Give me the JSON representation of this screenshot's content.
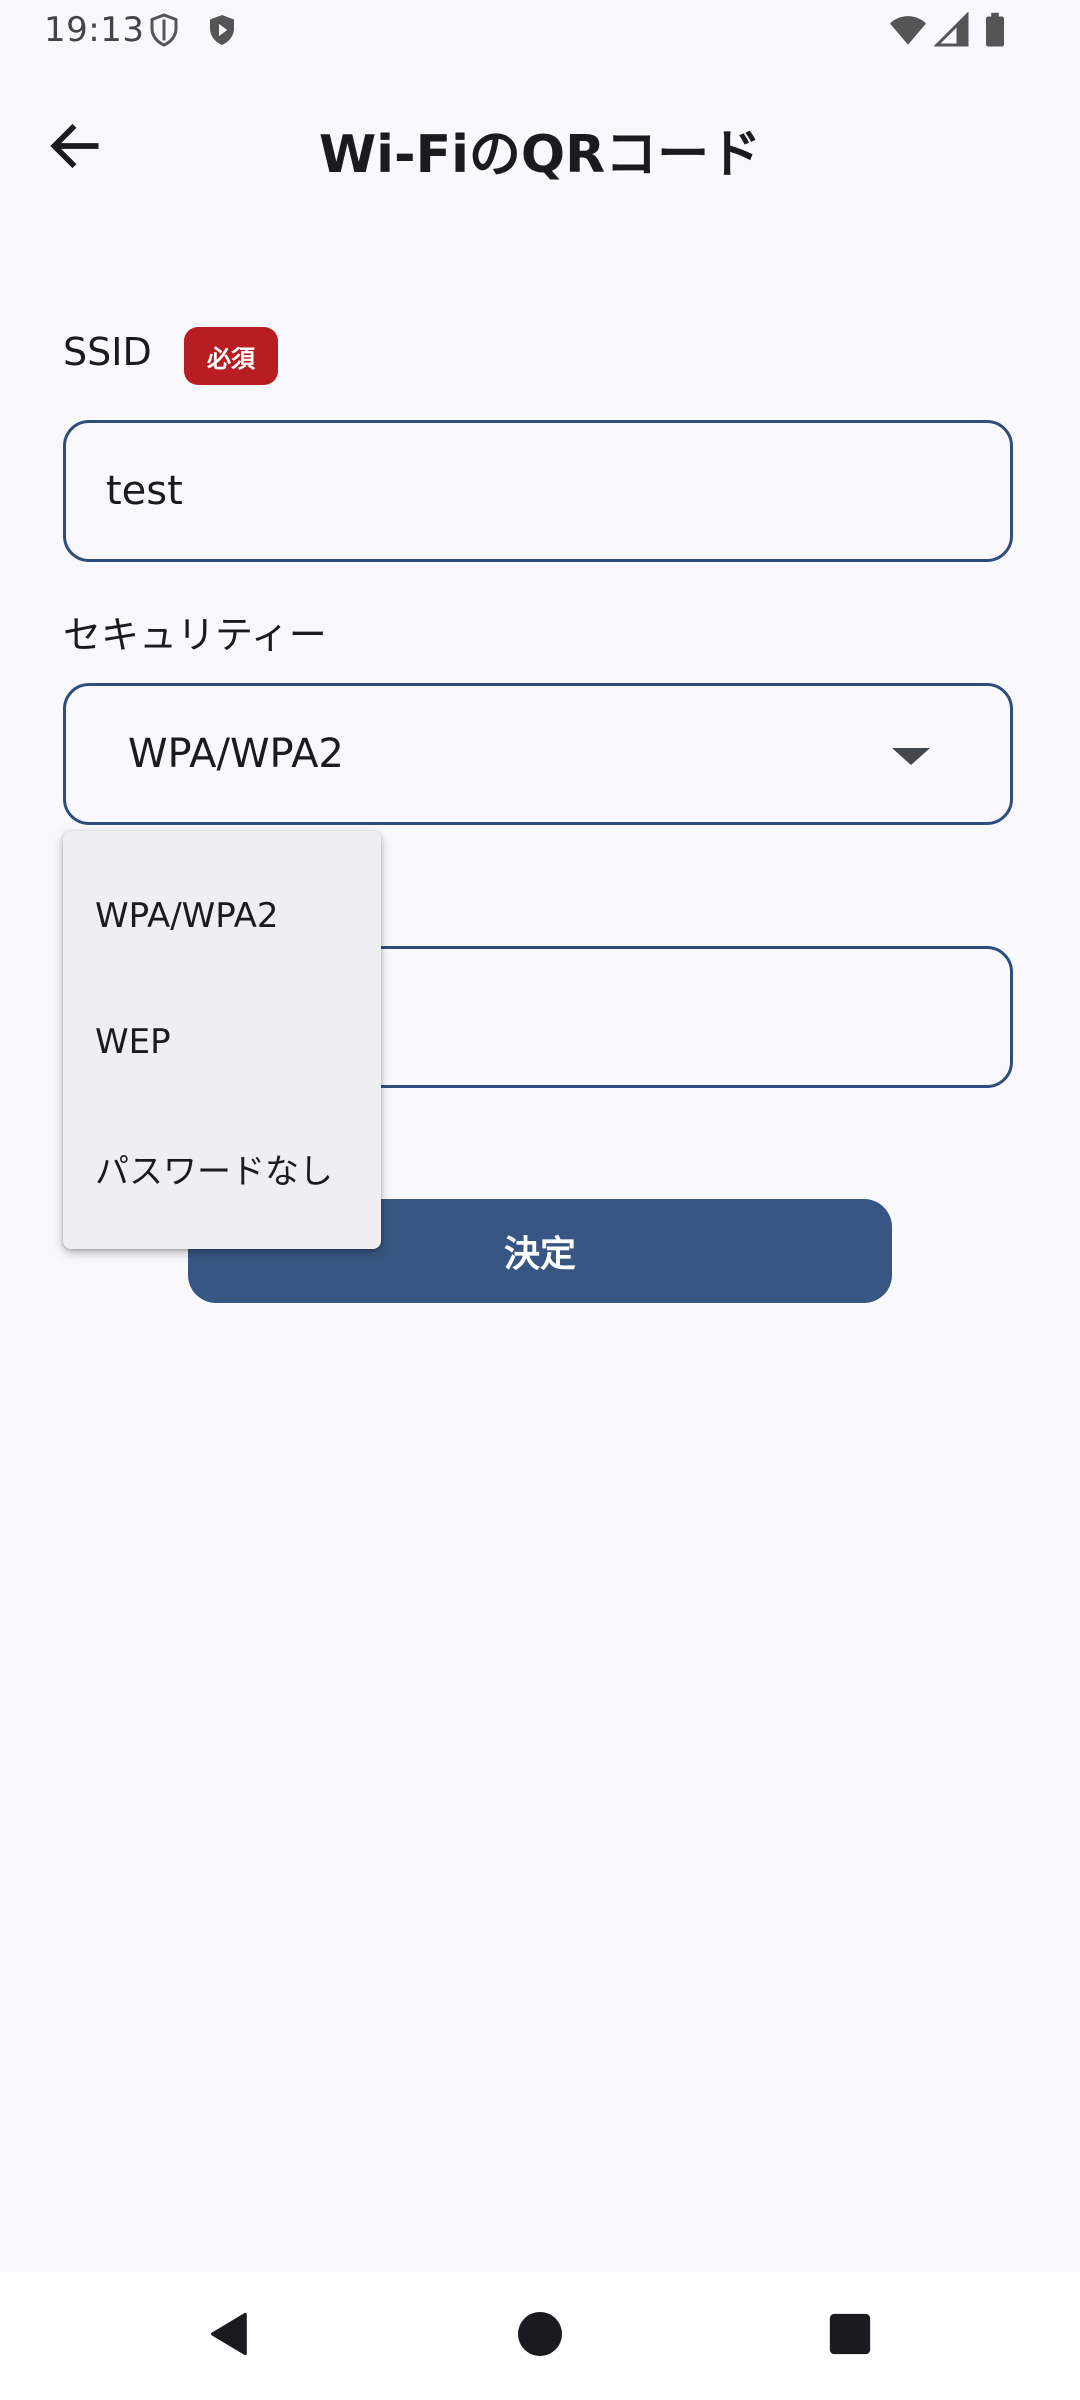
{
  "status_bar": {
    "time": "19:13",
    "left_icons": [
      "shield-outline-icon",
      "shield-play-icon"
    ],
    "right_icons": [
      "wifi-icon",
      "cell-signal-icon",
      "battery-icon"
    ]
  },
  "app_bar": {
    "back_icon": "arrow-back-icon",
    "title": "Wi-FiのQRコード"
  },
  "form": {
    "ssid": {
      "label": "SSID",
      "required_badge": "必須",
      "value": "test"
    },
    "security": {
      "label": "セキュリティー",
      "selected": "WPA/WPA2",
      "options": [
        "WPA/WPA2",
        "WEP",
        "パスワードなし"
      ]
    },
    "password": {
      "value": ""
    },
    "submit_label": "決定"
  },
  "colors": {
    "background": "#f9f8fd",
    "outline": "#2f4d7c",
    "primary_button": "#385683",
    "required_badge": "#b81d22",
    "menu_surface": "#efeef3"
  },
  "nav_bar": {
    "icons": [
      "nav-back-icon",
      "nav-home-icon",
      "nav-recents-icon"
    ]
  }
}
